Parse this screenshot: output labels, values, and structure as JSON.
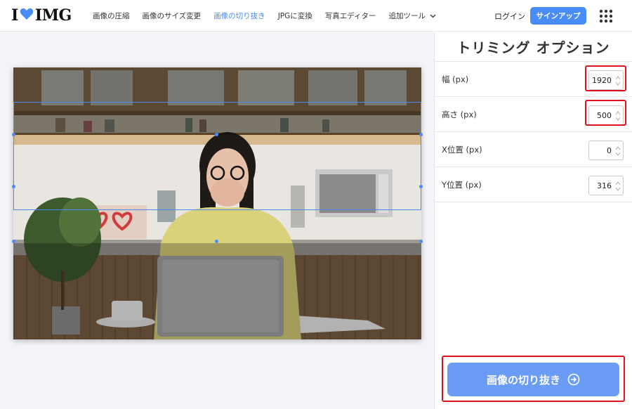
{
  "logo": {
    "prefix": "I",
    "suffix": "IMG"
  },
  "nav": {
    "items": [
      "画像の圧縮",
      "画像のサイズ変更",
      "画像の切り抜き",
      "JPGに変換",
      "写真エディター"
    ],
    "more_label": "追加ツール",
    "active_index": 2
  },
  "auth": {
    "login": "ログイン",
    "signup": "サインアップ"
  },
  "panel": {
    "title": "トリミング オプション",
    "options": [
      {
        "label": "幅 (px)",
        "value": "1920"
      },
      {
        "label": "高さ (px)",
        "value": "500"
      },
      {
        "label": "X位置 (px)",
        "value": "0"
      },
      {
        "label": "Y位置 (px)",
        "value": "316"
      }
    ],
    "crop_button": "画像の切り抜き"
  },
  "colors": {
    "accent": "#4a8cf7",
    "button": "#6b9cf5",
    "highlight": "#e0101e"
  }
}
